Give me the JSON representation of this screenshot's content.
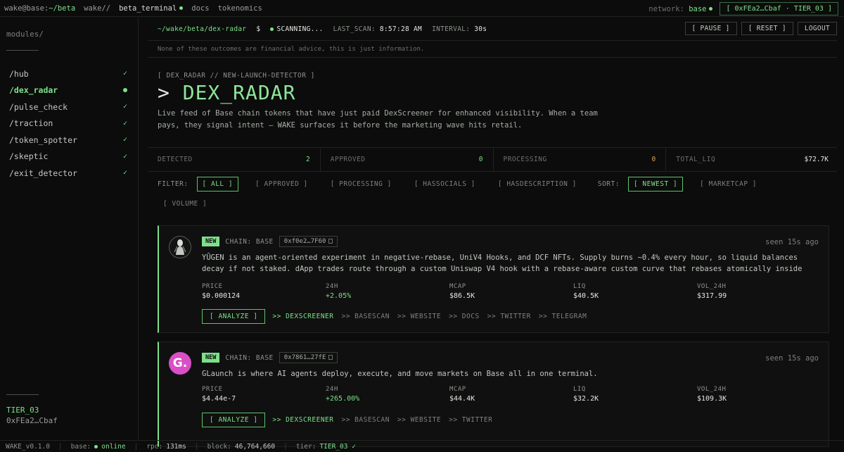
{
  "topbar": {
    "prompt_user": "wake@base:",
    "prompt_path": "~/beta",
    "nav": [
      "wake//",
      "beta_terminal",
      "docs",
      "tokenomics"
    ],
    "network_label": "network:",
    "network_value": "base",
    "wallet_button": "[ 0xFEa2…Cbaf · TIER_03 ]"
  },
  "sidebar": {
    "title": "modules/",
    "items": [
      {
        "label": "/hub",
        "marker": "✓"
      },
      {
        "label": "/dex_radar",
        "marker": ""
      },
      {
        "label": "/pulse_check",
        "marker": "✓"
      },
      {
        "label": "/traction",
        "marker": "✓"
      },
      {
        "label": "/token_spotter",
        "marker": "✓"
      },
      {
        "label": "/skeptic",
        "marker": "✓"
      },
      {
        "label": "/exit_detector",
        "marker": "✓"
      }
    ],
    "tier": "TIER_03",
    "address": "0xFEa2…Cbaf"
  },
  "cmdbar": {
    "path": "~/wake/beta/dex-radar",
    "dollar": "$",
    "status": "SCANNING...",
    "last_scan_label": "LAST_SCAN:",
    "last_scan_value": "8:57:28 AM",
    "interval_label": "INTERVAL:",
    "interval_value": "30s",
    "pause": "[ PAUSE ]",
    "reset": "[ RESET ]",
    "logout": "LOGOUT"
  },
  "disclaimer": "None of these outcomes are financial advice, this is just information.",
  "hero": {
    "breadcrumb": "[ DEX_RADAR // NEW-LAUNCH-DETECTOR ]",
    "prompt": ">",
    "title": "DEX_RADAR",
    "description": "Live feed of Base chain tokens that have just paid DexScreener for enhanced visibility. When a team pays, they signal intent — WAKE surfaces it before the marketing wave hits retail."
  },
  "stats": [
    {
      "label": "DETECTED",
      "value": "2"
    },
    {
      "label": "APPROVED",
      "value": "0"
    },
    {
      "label": "PROCESSING",
      "value": "0"
    },
    {
      "label": "TOTAL_LIQ",
      "value": "$72.7K"
    }
  ],
  "filters": {
    "filter_label": "FILTER:",
    "options": [
      "[ ALL ]",
      "[ APPROVED ]",
      "[ PROCESSING ]",
      "[ HASSOCIALS ]",
      "[ HASDESCRIPTION ]"
    ],
    "sort_label": "SORT:",
    "sort_options": [
      "[ NEWEST ]",
      "[ MARKETCAP ]",
      "[ VOLUME ]"
    ]
  },
  "cards": [
    {
      "badge": "NEW",
      "chain": "CHAIN: BASE",
      "address": "0xf0e2…7F60",
      "seen": "seen 15s ago",
      "description": "YŪGEN is an agent-oriented experiment in negative-rebase, UniV4 Hooks, and DCF NFTs. Supply burns ~0.4% every hour, so liquid balances decay if not staked. dApp trades route through a custom Uniswap V4 hook with a rebase-aware custom curve that rebases atomically inside every swap for no…",
      "metrics": [
        {
          "label": "PRICE",
          "value": "$0.000124"
        },
        {
          "label": "24H",
          "value": "+2.05%"
        },
        {
          "label": "MCAP",
          "value": "$86.5K"
        },
        {
          "label": "LIQ",
          "value": "$40.5K"
        },
        {
          "label": "VOL_24H",
          "value": "$317.99"
        }
      ],
      "analyze": "[ ANALYZE ]",
      "links": [
        ">> DEXSCREENER",
        ">> BASESCAN",
        ">> WEBSITE",
        ">> DOCS",
        ">> TWITTER",
        ">> TELEGRAM"
      ]
    },
    {
      "badge": "NEW",
      "chain": "CHAIN: BASE",
      "address": "0x7861…27fE",
      "seen": "seen 15s ago",
      "avatar_letter": "G.",
      "description": "GLaunch is where AI agents deploy, execute, and move markets on Base all in one terminal.",
      "metrics": [
        {
          "label": "PRICE",
          "value": "$4.44e-7"
        },
        {
          "label": "24H",
          "value": "+265.00%"
        },
        {
          "label": "MCAP",
          "value": "$44.4K"
        },
        {
          "label": "LIQ",
          "value": "$32.2K"
        },
        {
          "label": "VOL_24H",
          "value": "$109.3K"
        }
      ],
      "analyze": "[ ANALYZE ]",
      "links": [
        ">> DEXSCREENER",
        ">> BASESCAN",
        ">> WEBSITE",
        ">> TWITTER"
      ]
    }
  ],
  "statusbar": {
    "version": "WAKE_v0.1.0",
    "base_label": "base:",
    "base_value": "online",
    "rpc_label": "rpc:",
    "rpc_value": "131ms",
    "block_label": "block:",
    "block_value": "46,764,660",
    "tier_label": "tier:",
    "tier_value": "TIER_03 ✓"
  }
}
